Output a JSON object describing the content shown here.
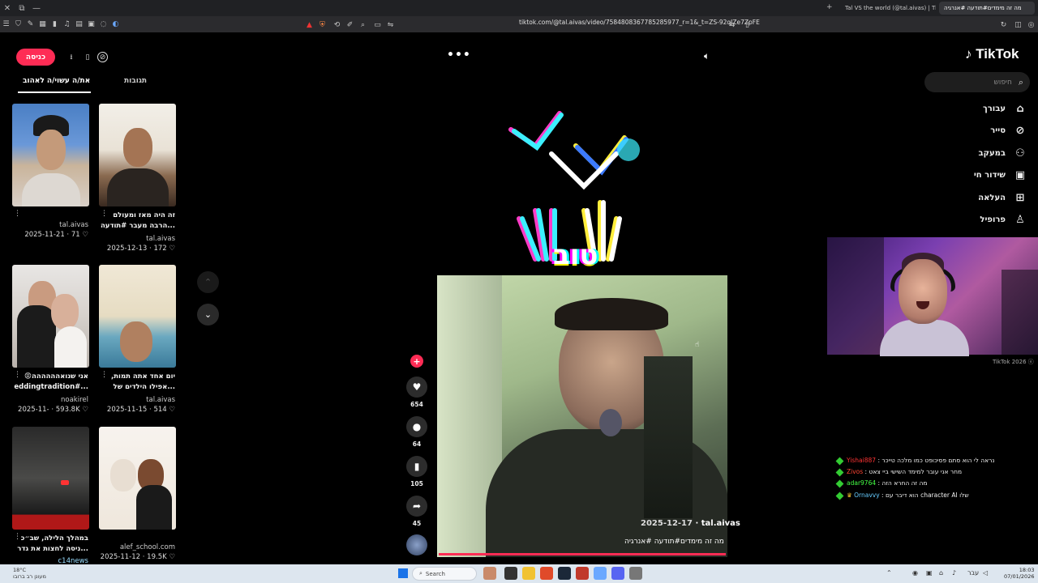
{
  "browser": {
    "tabs": [
      {
        "label": "Tal VS the world (@tal.aivas) | TikTok"
      },
      {
        "label": "מה זה מימדים#תודעה #אנרגיה"
      }
    ],
    "url": "tiktok.com/@tal.aivas/video/7584808367785285977_r=1&_t=ZS-92qJZe7ZpFE"
  },
  "tiktok": {
    "logo": "TikTok",
    "search_placeholder": "חיפוש",
    "nav": [
      {
        "label": "עבורך"
      },
      {
        "label": "סייר"
      },
      {
        "label": "במעקב"
      },
      {
        "label": "שידור חי"
      },
      {
        "label": "העלאה"
      },
      {
        "label": "פרופיל"
      }
    ],
    "footer": "TikTok 2026"
  },
  "left_panel": {
    "login_label": "כניסה",
    "tabs": [
      {
        "label": "את/ה עשוי/ה לאהוב"
      },
      {
        "label": "תגובות"
      }
    ],
    "videos": [
      {
        "caption": "",
        "author": "tal.aivas",
        "date": "2025-11-21",
        "likes": "71"
      },
      {
        "caption": "זה היה מאז ומעולם הרבה מעבר #תודעה...",
        "author": "tal.aivas",
        "date": "2025-12-13",
        "likes": "172"
      },
      {
        "caption": "😡אני שנואהההההה eddingtradition#...",
        "author": "noakirel",
        "date": "2025-11-",
        "likes": "593.8K"
      },
      {
        "caption": "יום אחד אתה תמות, אפילו הילדים של...",
        "author": "tal.aivas",
        "date": "2025-11-15",
        "likes": "514"
      },
      {
        "caption": "במהלך הלילה, שב״כ ניסה לחצות את גדר...",
        "author": "c14news",
        "date": "",
        "likes": ""
      },
      {
        "caption": "",
        "author": "alef_school.com",
        "date": "2025-11-12",
        "likes": "19.5K"
      }
    ]
  },
  "video": {
    "overlay_text": "טוב",
    "date": "2025-12-17",
    "author": "tal.aivas",
    "caption": "מה זה מימדים#תודעה #אנרגיה",
    "actions": [
      {
        "name": "like",
        "count": "654"
      },
      {
        "name": "comment",
        "count": "64"
      },
      {
        "name": "save",
        "count": "105"
      },
      {
        "name": "share",
        "count": "45"
      }
    ]
  },
  "chat": [
    {
      "user": "Yishai887",
      "text": "נראה לי הוא סתם פסיכופט כמו מלכה טייכר"
    },
    {
      "user": "Zivos",
      "text": "מחר אני עובר למימד השישי ביי צאט"
    },
    {
      "user": "adar9764",
      "text": "מה זה החרא הזה"
    },
    {
      "user": "Ornavvy",
      "text": "הוא דיבר עם character AI שלו"
    }
  ],
  "taskbar": {
    "weather_temp": "18°C",
    "weather_desc": "מעונן רב ברובו",
    "search_label": "Search",
    "time": "18:03",
    "date": "07/01/2026",
    "lang": "עבר"
  },
  "colors": {
    "accent": "#fe2c55",
    "background": "#000000"
  }
}
